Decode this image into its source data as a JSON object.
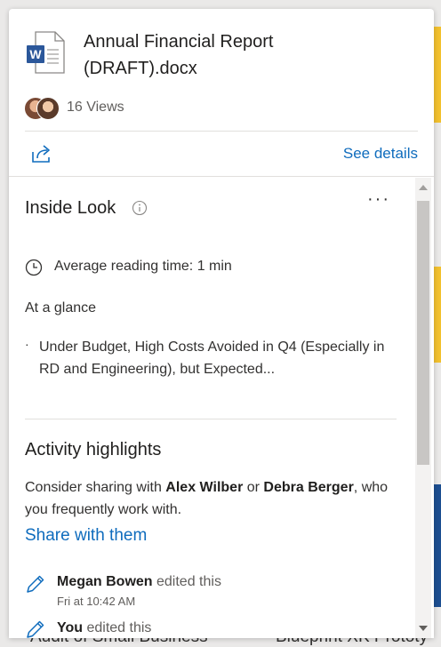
{
  "document": {
    "title_line1": "Annual Financial Report",
    "title_line2": "(DRAFT).docx",
    "file_type_letter": "W",
    "views": "16 Views"
  },
  "header": {
    "see_details": "See details",
    "share_icon": "share-icon"
  },
  "inside_look": {
    "title": "Inside Look",
    "reading_time": "Average reading time: 1 min",
    "at_a_glance": "At a glance",
    "bullets": [
      "Under Budget, High Costs Avoided in Q4 (Especially in RD and Engineering), but Expected..."
    ]
  },
  "activity": {
    "title": "Activity highlights",
    "consider_prefix": "Consider sharing with ",
    "person1": "Alex Wilber",
    "or": " or ",
    "person2": "Debra Berger",
    "consider_suffix": ", who you frequently work with.",
    "share_link": "Share with them",
    "items": [
      {
        "name": "Megan Bowen",
        "verb": " edited this",
        "time": "Fri at 10:42 AM"
      },
      {
        "name": "You",
        "verb": " edited this",
        "time": ""
      }
    ]
  },
  "background": {
    "left_text": "Audit of Small Business",
    "right_text": "Blueprint XK Prototy"
  },
  "colors": {
    "accent": "#0f6cbd",
    "word_blue": "#2b579a",
    "yellow_strip": "#f2c12e",
    "navy_strip": "#1d4f91"
  }
}
